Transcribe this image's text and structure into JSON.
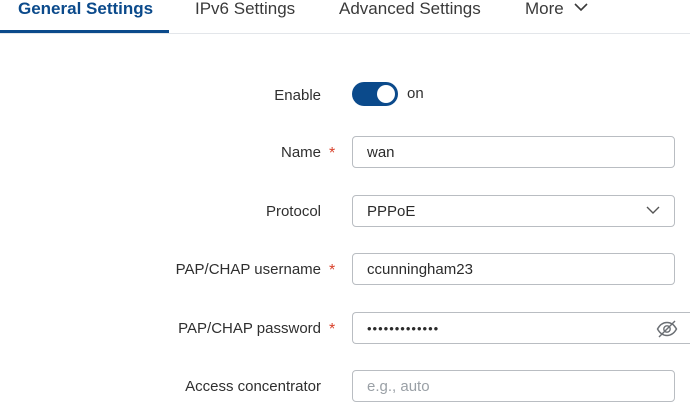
{
  "tabs": [
    {
      "label": "General Settings",
      "active": true
    },
    {
      "label": "IPv6 Settings"
    },
    {
      "label": "Advanced Settings"
    },
    {
      "label": "More"
    }
  ],
  "form": {
    "enable": {
      "label": "Enable",
      "state": "on"
    },
    "name": {
      "label": "Name",
      "required_mark": "*",
      "value": "wan"
    },
    "protocol": {
      "label": "Protocol",
      "value": "PPPoE"
    },
    "username": {
      "label": "PAP/CHAP username",
      "required_mark": "*",
      "value": "ccunningham23"
    },
    "password": {
      "label": "PAP/CHAP password",
      "required_mark": "*",
      "masked_value": "•••••••••••••"
    },
    "access_concentrator": {
      "label": "Access concentrator",
      "placeholder": "e.g., auto"
    }
  },
  "colors": {
    "accent": "#0b4a8b",
    "required": "#d8412b",
    "border": "#b9bdc2"
  },
  "icons": {
    "more": "chevron-down-icon",
    "select": "chevron-down-icon",
    "password": "eye-slash-icon"
  }
}
